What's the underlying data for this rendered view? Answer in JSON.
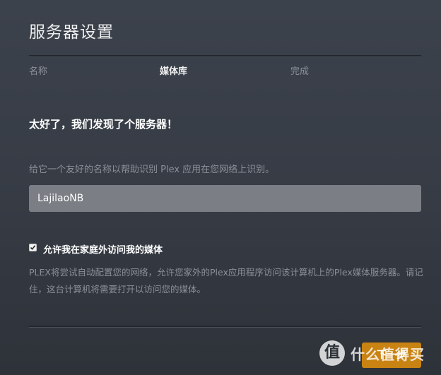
{
  "header": {
    "title": "服务器设置"
  },
  "steps": [
    {
      "label": "名称",
      "active": false
    },
    {
      "label": "媒体库",
      "active": true
    },
    {
      "label": "完成",
      "active": false
    }
  ],
  "main": {
    "heading": "太好了，我们发现了个服务器！",
    "description": "给它一个友好的名称以帮助识别 Plex 应用在您网络上识别。",
    "server_name_value": "LajilaoNB",
    "remote_access": {
      "checked": true,
      "label": "允许我在家庭外访问我的媒体",
      "help": "PLEX将尝试自动配置您的网络，允许您家外的Plex应用程序访问该计算机上的Plex媒体服务器。请记住，这台计算机将需要打开以访问您的媒体。"
    }
  },
  "footer": {
    "next_label": "下一步"
  },
  "watermark": {
    "glyph": "值",
    "text": "什么值得买"
  },
  "colors": {
    "background": "#3a3f48",
    "accent": "#c98312",
    "input_bg": "#7b7e84",
    "muted_text": "#8b9098"
  }
}
